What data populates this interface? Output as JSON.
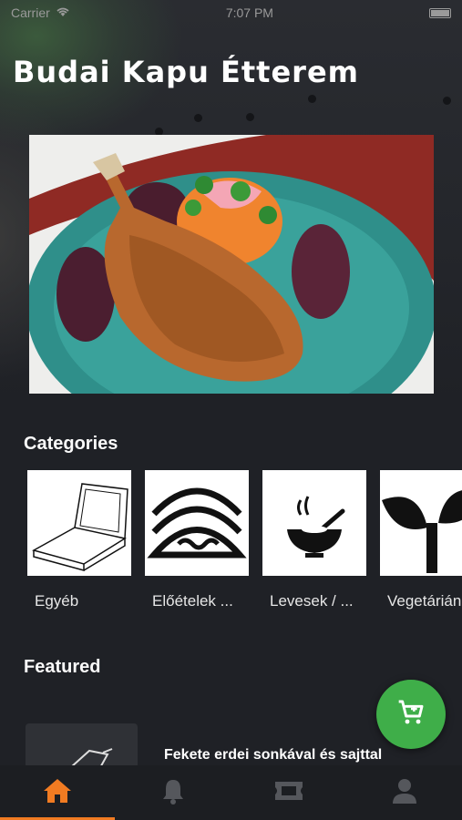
{
  "status_bar": {
    "carrier": "Carrier",
    "time": "7:07 PM"
  },
  "header": {
    "title": "Budai Kapu Étterem"
  },
  "categories": {
    "heading": "Categories",
    "items": [
      {
        "label": "Egyéb",
        "icon": "pizza-box-icon"
      },
      {
        "label": "Előételek ...",
        "icon": "tacos-icon"
      },
      {
        "label": "Levesek / ...",
        "icon": "soup-bowl-icon"
      },
      {
        "label": "Vegetárián",
        "icon": "sprout-icon"
      }
    ]
  },
  "featured": {
    "heading": "Featured",
    "items": [
      {
        "title": "Fekete erdei sonkával és sajttal"
      }
    ]
  },
  "cart_button": {
    "icon": "cart-icon",
    "color": "#3fae49"
  },
  "tabbar": {
    "active_color": "#f07b22",
    "items": [
      {
        "icon": "home-icon",
        "active": true
      },
      {
        "icon": "bell-icon",
        "active": false
      },
      {
        "icon": "ticket-icon",
        "active": false
      },
      {
        "icon": "user-icon",
        "active": false
      }
    ]
  }
}
